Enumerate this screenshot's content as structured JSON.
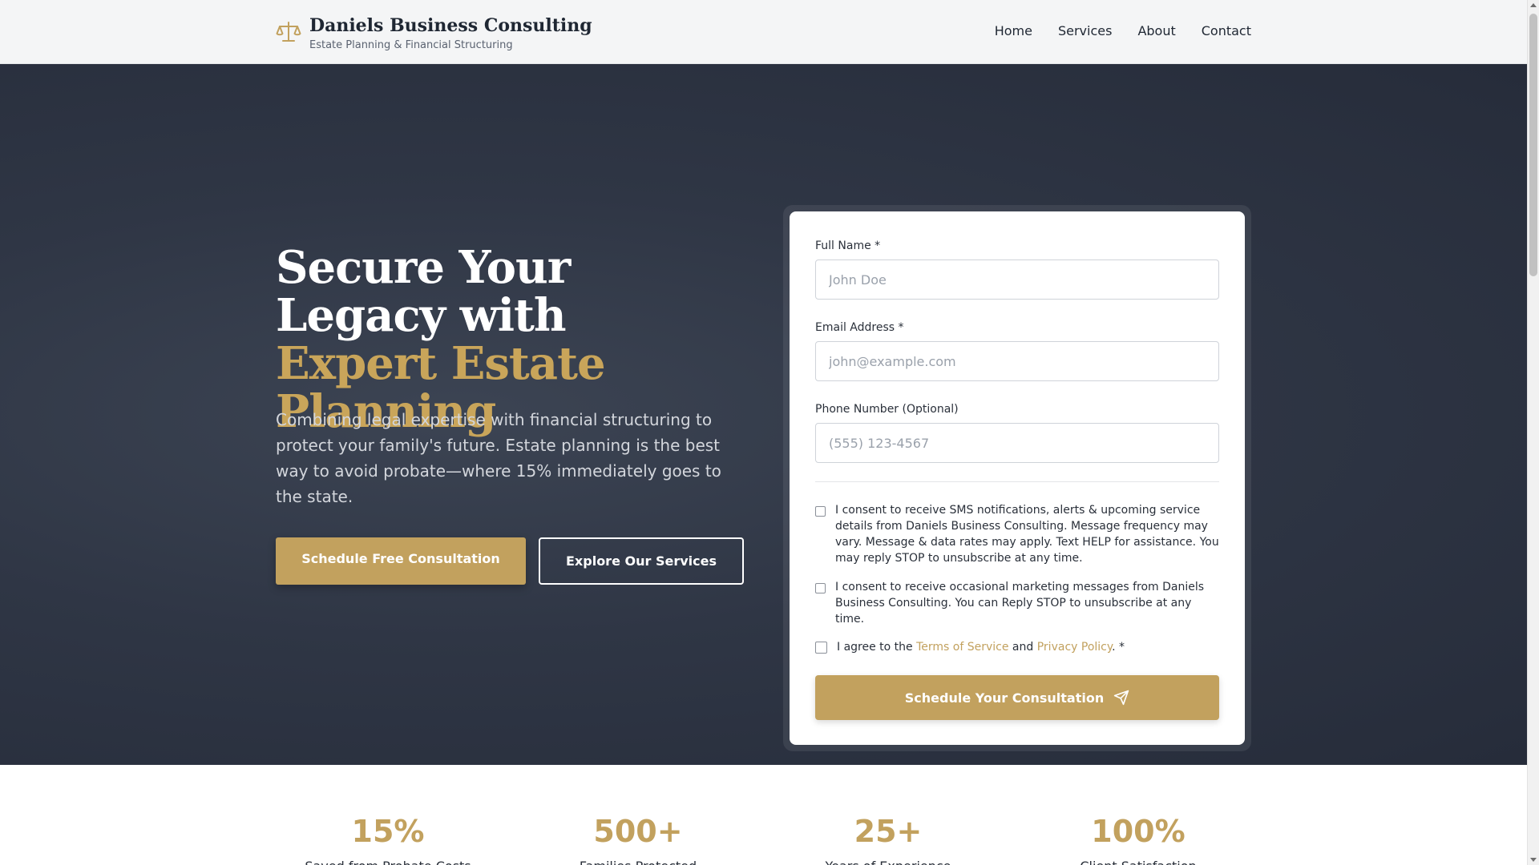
{
  "header": {
    "brand_title": "Daniels Business Consulting",
    "brand_subtitle": "Estate Planning & Financial Structuring",
    "brand_icon": "scales-icon",
    "nav": [
      "Home",
      "Services",
      "About",
      "Contact"
    ]
  },
  "hero": {
    "headline_part1": "Secure Your Legacy with ",
    "headline_highlight": "Expert Estate Planning",
    "lead": "Combining legal expertise with financial structuring to protect your family's future. Estate planning is the best way to avoid probate—where 15% immediately goes to the state.",
    "primary_button": "Schedule Free Consultation",
    "secondary_button": "Explore Our Services"
  },
  "form": {
    "full_name_label": "Full Name *",
    "full_name_placeholder": "John Doe",
    "email_label": "Email Address *",
    "email_placeholder": "john@example.com",
    "phone_label": "Phone Number (Optional)",
    "phone_placeholder": "(555) 123-4567",
    "sms_consent": "I consent to receive SMS notifications, alerts & upcoming service details from Daniels Business Consulting. Message frequency may vary. Message & data rates may apply. Text HELP for assistance. You may reply STOP to unsubscribe at any time.",
    "marketing_consent": "I consent to receive occasional marketing messages from Daniels Business Consulting. You can Reply STOP to unsubscribe at any time.",
    "terms_prefix": "I agree to the ",
    "terms_link": "Terms of Service",
    "terms_and": " and ",
    "privacy_link": "Privacy Policy",
    "terms_suffix": ". *",
    "submit_label": "Schedule Your Consultation",
    "submit_icon": "send-icon"
  },
  "stats": [
    {
      "value": "15%",
      "label": "Saved from Probate Costs"
    },
    {
      "value": "500+",
      "label": "Families Protected"
    },
    {
      "value": "25+",
      "label": "Years of Experience"
    },
    {
      "value": "100%",
      "label": "Client Satisfaction"
    }
  ],
  "colors": {
    "accent_gold": "#c2a15e",
    "hero_bg": "#2f3645",
    "text_dark": "#1f2733"
  }
}
